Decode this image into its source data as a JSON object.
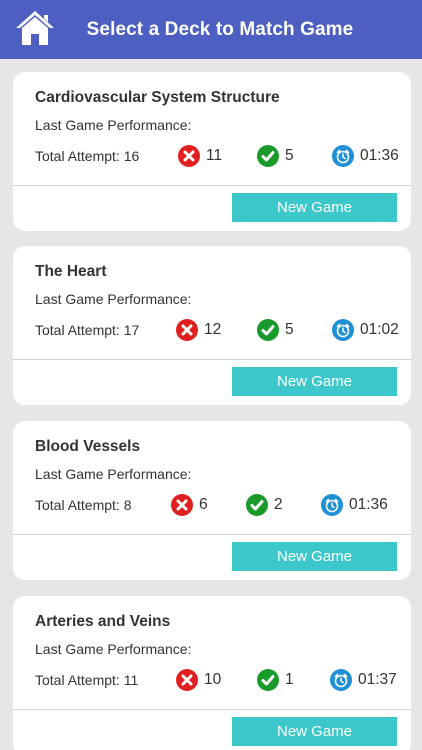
{
  "header": {
    "title": "Select a Deck to Match Game",
    "home_icon": "home-icon",
    "color": "#4d5fc0"
  },
  "labels": {
    "last_game": "Last Game Performance:",
    "new_game": "New Game"
  },
  "colors": {
    "wrong": "#e02020",
    "correct": "#1a9a2a",
    "timer": "#1f8fd6",
    "button": "#3cc8ca"
  },
  "decks": [
    {
      "title": "Cardiovascular System Structure",
      "attempts": "Total Attempt: 16",
      "wrong": "11",
      "correct": "5",
      "time": "01:36"
    },
    {
      "title": "The Heart",
      "attempts": "Total Attempt: 17",
      "wrong": "12",
      "correct": "5",
      "time": "01:02"
    },
    {
      "title": "Blood Vessels",
      "attempts": "Total Attempt: 8",
      "wrong": "6",
      "correct": "2",
      "time": "01:36"
    },
    {
      "title": "Arteries and Veins",
      "attempts": "Total Attempt: 11",
      "wrong": "10",
      "correct": "1",
      "time": "01:37"
    }
  ]
}
